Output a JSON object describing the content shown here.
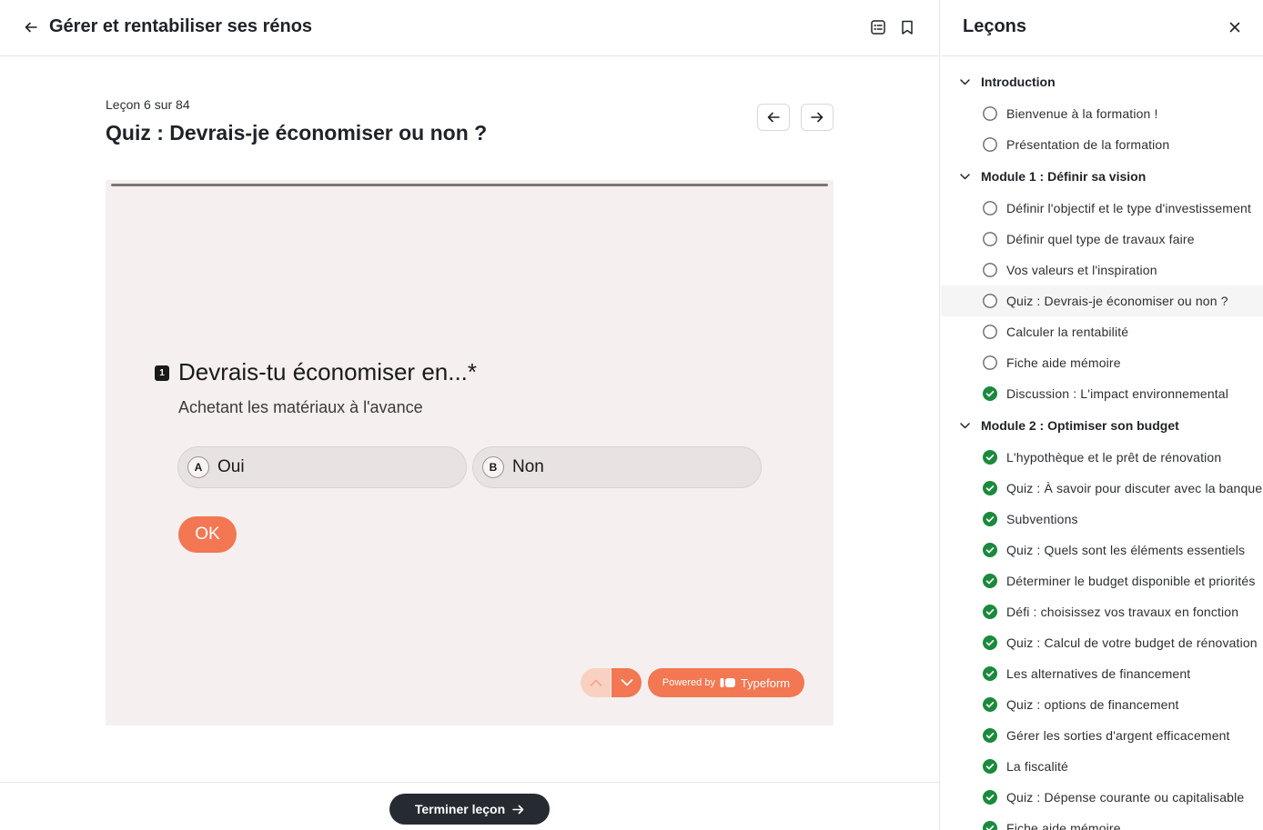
{
  "header": {
    "course_title": "Gérer et rentabiliser ses rénos"
  },
  "lesson": {
    "counter": "Leçon 6 sur 84",
    "title": "Quiz : Devrais-je économiser ou non ?"
  },
  "quiz": {
    "question_number": "1",
    "question": "Devrais-tu économiser en...*",
    "subtitle": "Achetant les matériaux à l'avance",
    "choices": [
      {
        "key": "A",
        "label": "Oui"
      },
      {
        "key": "B",
        "label": "Non"
      }
    ],
    "ok_label": "OK",
    "powered_by": "Powered by",
    "brand": "Typeform",
    "colors": {
      "accent": "#f27752",
      "background": "#f5f0ef"
    }
  },
  "footer": {
    "finish_label": "Terminer leçon"
  },
  "sidebar": {
    "title": "Leçons",
    "modules": [
      {
        "title": "Introduction",
        "lessons": [
          {
            "label": "Bienvenue à la formation !",
            "status": "incomplete"
          },
          {
            "label": "Présentation de la formation",
            "status": "incomplete"
          }
        ]
      },
      {
        "title": "Module 1 : Définir sa vision",
        "lessons": [
          {
            "label": "Définir l'objectif et le type d'investissement",
            "status": "incomplete"
          },
          {
            "label": "Définir quel type de travaux faire",
            "status": "incomplete"
          },
          {
            "label": "Vos valeurs et l'inspiration",
            "status": "incomplete"
          },
          {
            "label": "Quiz : Devrais-je économiser ou non ?",
            "status": "incomplete",
            "active": true
          },
          {
            "label": "Calculer la rentabilité",
            "status": "incomplete"
          },
          {
            "label": "Fiche aide mémoire",
            "status": "incomplete"
          },
          {
            "label": "Discussion : L'impact environnemental",
            "status": "complete"
          }
        ]
      },
      {
        "title": "Module 2 : Optimiser son budget",
        "lessons": [
          {
            "label": "L'hypothèque et le prêt de rénovation",
            "status": "complete"
          },
          {
            "label": "Quiz : À savoir pour discuter avec la banque",
            "status": "complete"
          },
          {
            "label": "Subventions",
            "status": "complete"
          },
          {
            "label": "Quiz : Quels sont les éléments essentiels",
            "status": "complete"
          },
          {
            "label": "Déterminer le budget disponible et priorités",
            "status": "complete"
          },
          {
            "label": "Défi : choisissez vos travaux en fonction",
            "status": "complete"
          },
          {
            "label": "Quiz : Calcul de votre budget de rénovation",
            "status": "complete"
          },
          {
            "label": "Les alternatives de financement",
            "status": "complete"
          },
          {
            "label": "Quiz : options de financement",
            "status": "complete"
          },
          {
            "label": "Gérer les sorties d'argent efficacement",
            "status": "complete"
          },
          {
            "label": "La fiscalité",
            "status": "complete"
          },
          {
            "label": "Quiz : Dépense courante ou capitalisable",
            "status": "complete"
          },
          {
            "label": "Fiche aide mémoire",
            "status": "complete"
          }
        ]
      }
    ],
    "colors": {
      "complete": "#1a8a3c",
      "incomplete_border": "#6b6b6b"
    }
  }
}
